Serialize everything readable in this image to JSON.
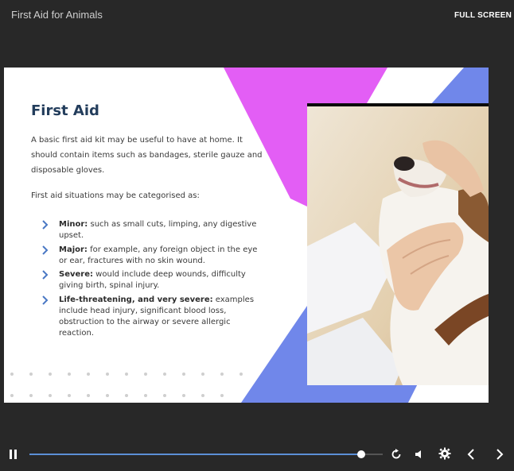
{
  "header": {
    "app_title": "First Aid for Animals",
    "fullscreen_label": "FULL SCREEN"
  },
  "slide": {
    "title": "First Aid",
    "intro": "A basic first aid kit may be useful to have at home. It should contain items such as bandages, sterile gauze and disposable gloves.",
    "lead": "First aid situations may be categorised as:",
    "bullets": [
      {
        "term": "Minor:",
        "text": " such as small cuts, limping, any digestive upset."
      },
      {
        "term": "Major:",
        "text": " for example, any foreign object in the eye or ear, fractures with no skin wound."
      },
      {
        "term": "Severe:",
        "text": " would include deep wounds, difficulty giving birth, spinal injury."
      },
      {
        "term": "Life-threatening, and very severe:",
        "text": " examples include head injury, significant blood loss, obstruction to the airway or severe allergic reaction."
      }
    ],
    "photo_subject": "Vet examining a dog's teeth"
  },
  "player": {
    "progress": 0.94,
    "icons": [
      "pause-icon",
      "replay-icon",
      "volume-icon",
      "settings-icon",
      "prev-icon",
      "next-icon"
    ],
    "accent": "#5b8fd6"
  },
  "colors": {
    "magenta": "#e35ef5",
    "blue": "#7087ea",
    "title": "#233d5c",
    "chevron": "#4a78c4",
    "bg": "#282828"
  }
}
